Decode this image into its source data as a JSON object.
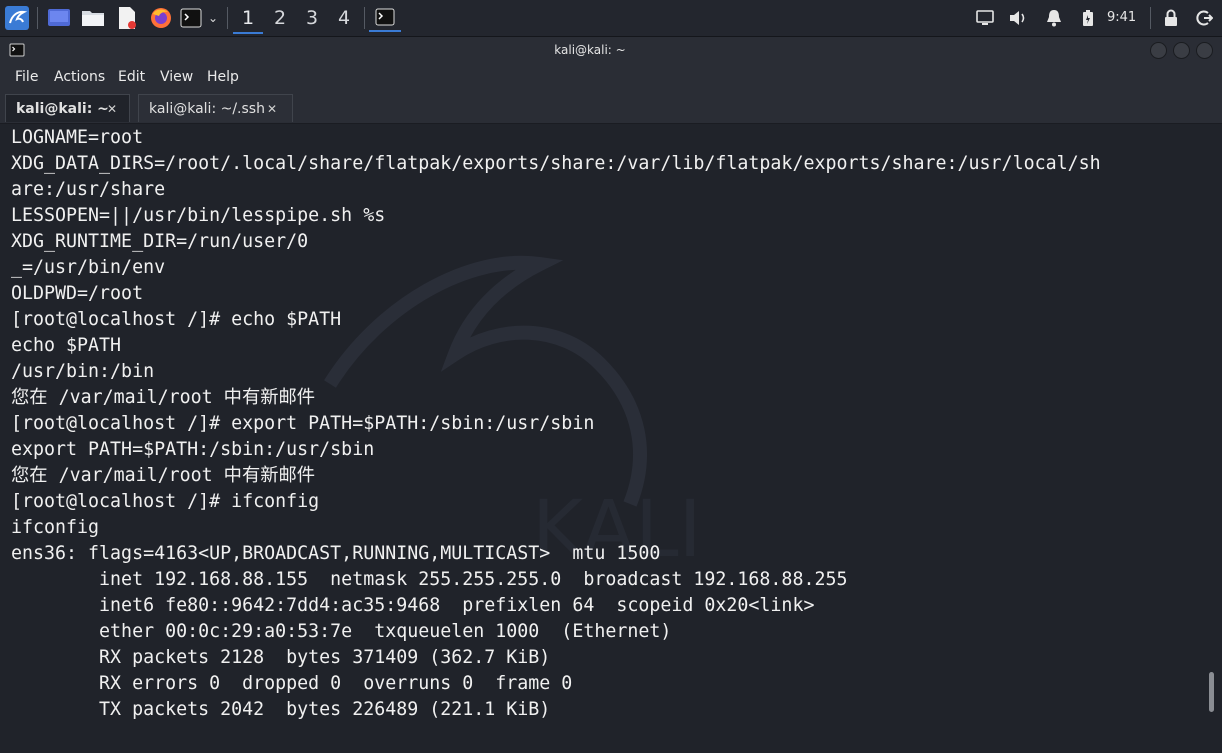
{
  "panel": {
    "workspaces": [
      "1",
      "2",
      "3",
      "4"
    ],
    "clock": "9:41",
    "icons": [
      "kali-menu-icon",
      "desktop-icon",
      "files-icon",
      "text-editor-icon",
      "firefox-icon",
      "terminal-icon",
      "dropdown-icon",
      "terminal-task-icon",
      "display-icon",
      "volume-icon",
      "notification-bell-icon",
      "battery-icon",
      "lock-icon",
      "logout-icon"
    ]
  },
  "window": {
    "title": "kali@kali: ~",
    "menu": [
      "File",
      "Actions",
      "Edit",
      "View",
      "Help"
    ],
    "tabs": [
      {
        "label": "kali@kali: ~",
        "close": "✕"
      },
      {
        "label": "kali@kali: ~/.ssh",
        "close": "✕"
      }
    ]
  },
  "terminal": {
    "lines": [
      "LOGNAME=root",
      "XDG_DATA_DIRS=/root/.local/share/flatpak/exports/share:/var/lib/flatpak/exports/share:/usr/local/sh",
      "are:/usr/share",
      "LESSOPEN=||/usr/bin/lesspipe.sh %s",
      "XDG_RUNTIME_DIR=/run/user/0",
      "_=/usr/bin/env",
      "OLDPWD=/root",
      "[root@localhost /]# echo $PATH",
      "echo $PATH",
      "/usr/bin:/bin",
      "您在 /var/mail/root 中有新邮件",
      "[root@localhost /]# export PATH=$PATH:/sbin:/usr/sbin",
      "export PATH=$PATH:/sbin:/usr/sbin",
      "您在 /var/mail/root 中有新邮件",
      "[root@localhost /]# ifconfig",
      "ifconfig",
      "ens36: flags=4163<UP,BROADCAST,RUNNING,MULTICAST>  mtu 1500",
      "        inet 192.168.88.155  netmask 255.255.255.0  broadcast 192.168.88.255",
      "        inet6 fe80::9642:7dd4:ac35:9468  prefixlen 64  scopeid 0x20<link>",
      "        ether 00:0c:29:a0:53:7e  txqueuelen 1000  (Ethernet)",
      "        RX packets 2128  bytes 371409 (362.7 KiB)",
      "        RX errors 0  dropped 0  overruns 0  frame 0",
      "        TX packets 2042  bytes 226489 (221.1 KiB)"
    ]
  },
  "colors": {
    "panel_bg": "#23262e",
    "terminal_bg": "#20232a",
    "text": "#f0f0f0",
    "accent": "#3a7bd5"
  }
}
